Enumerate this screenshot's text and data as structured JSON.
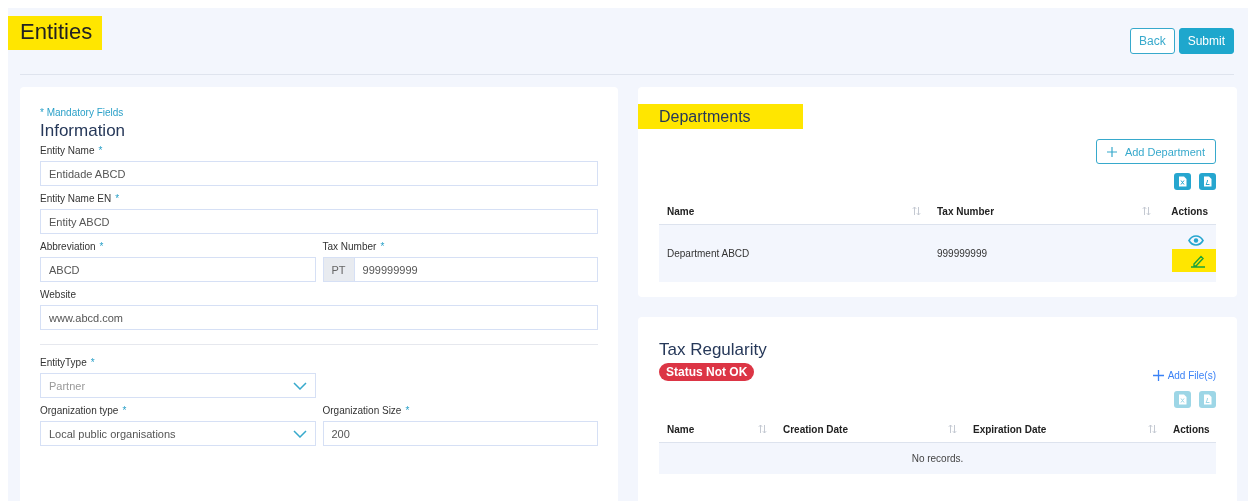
{
  "page": {
    "title": "Entities",
    "title_highlighted": true
  },
  "actions": [
    {
      "label": "Back",
      "kind": "outline"
    },
    {
      "label": "Submit",
      "kind": "primary"
    }
  ],
  "information": {
    "mandatory_note": "* Mandatory Fields",
    "title": "Information",
    "rows": [
      {
        "kind": "fields",
        "fields": [
          {
            "label": "Entity Name",
            "required_mark": "*",
            "kind": "text",
            "value": "Entidade ABCD"
          }
        ]
      },
      {
        "kind": "fields",
        "fields": [
          {
            "label": "Entity Name EN",
            "required_mark": "*",
            "kind": "text",
            "value": "Entity ABCD"
          }
        ]
      },
      {
        "kind": "fields",
        "fields": [
          {
            "label": "Abbreviation",
            "required_mark": "*",
            "kind": "text",
            "value": "ABCD"
          },
          {
            "label": "Tax Number",
            "required_mark": "*",
            "kind": "prefixed",
            "prefix": "PT",
            "value": "999999999"
          }
        ]
      },
      {
        "kind": "fields",
        "fields": [
          {
            "label": "Website",
            "kind": "text",
            "value": "www.abcd.com"
          }
        ]
      },
      {
        "kind": "divider"
      },
      {
        "kind": "fields",
        "fields": [
          {
            "label": "EntityType",
            "required_mark": "*",
            "kind": "select",
            "value": "Partner",
            "disabled": true
          },
          {
            "kind": "empty"
          }
        ]
      },
      {
        "kind": "fields",
        "fields": [
          {
            "label": "Organization type",
            "required_mark": "*",
            "kind": "select",
            "value": "Local public organisations",
            "disabled": false
          },
          {
            "label": "Organization Size",
            "required_mark": "*",
            "kind": "text",
            "value": "200"
          }
        ]
      }
    ]
  },
  "departments": {
    "title": "Departments",
    "title_highlighted": true,
    "add_button": "Add Department",
    "exports_disabled": false,
    "columns": [
      {
        "label": "Name",
        "sortable": true
      },
      {
        "label": "Tax Number",
        "sortable": true
      },
      {
        "label": "Actions",
        "sortable": false
      }
    ],
    "rows": [
      {
        "name": "Department ABCD",
        "tax_number": "999999999",
        "edit_highlighted": true
      }
    ]
  },
  "tax_regularity": {
    "title": "Tax Regularity",
    "status": "Status Not OK",
    "status_ok": false,
    "add_link": "Add File(s)",
    "exports_disabled": true,
    "columns": [
      {
        "label": "Name",
        "sortable": true
      },
      {
        "label": "Creation Date",
        "sortable": true
      },
      {
        "label": "Expiration Date",
        "sortable": true
      },
      {
        "label": "Actions",
        "sortable": false
      }
    ],
    "empty_message": "No records."
  }
}
